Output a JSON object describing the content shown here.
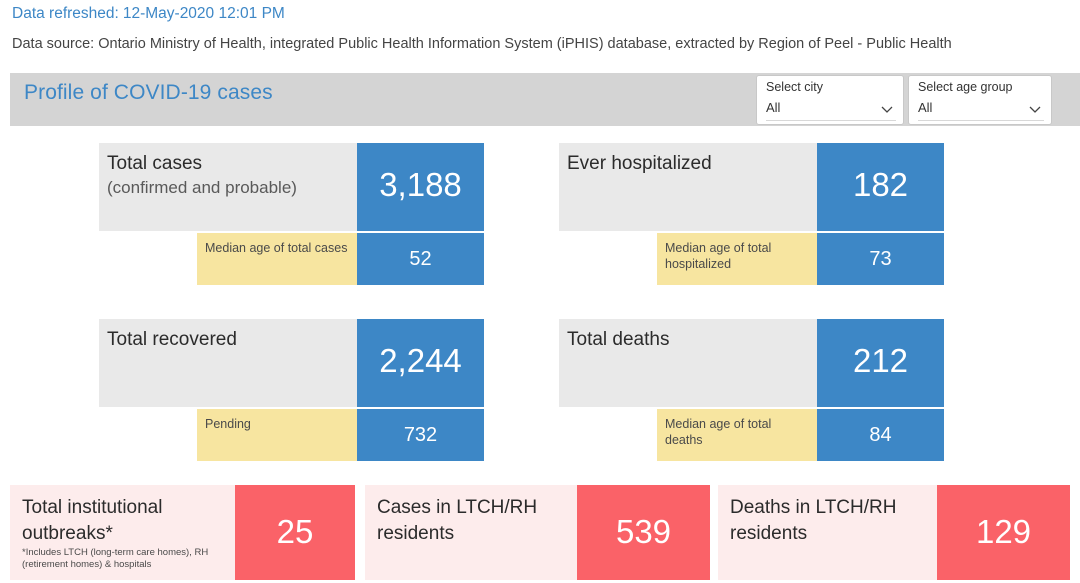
{
  "meta": {
    "refreshed_label": "Data refreshed:",
    "refreshed_value": "12-May-2020 12:01 PM",
    "source": "Data source: Ontario Ministry of Health, integrated Public Health Information System (iPHIS) database, extracted by Region of Peel - Public Health"
  },
  "header": {
    "title": "Profile of COVID-19 cases",
    "band_color": "#d4d4d4",
    "title_color": "#3d87c6"
  },
  "slicers": [
    {
      "label": "Select city",
      "value": "All",
      "icon": "chevron-down-icon"
    },
    {
      "label": "Select age group",
      "value": "All",
      "icon": "chevron-down-icon"
    }
  ],
  "kpi_cards": [
    {
      "title": "Total cases",
      "subtitle": "(confirmed and probable)",
      "value": "3,188",
      "sub_label": "Median age of total cases",
      "sub_value": "52"
    },
    {
      "title": "Ever hospitalized",
      "subtitle": "",
      "value": "182",
      "sub_label": "Median age of total hospitalized",
      "sub_value": "73"
    },
    {
      "title": "Total recovered",
      "subtitle": "",
      "value": "2,244",
      "sub_label": "Pending",
      "sub_value": "732"
    },
    {
      "title": "Total deaths",
      "subtitle": "",
      "value": "212",
      "sub_label": "Median age of total deaths",
      "sub_value": "84"
    }
  ],
  "outbreak_cards": [
    {
      "title": "Total institutional outbreaks*",
      "note": "*Includes LTCH (long-term care homes), RH (retirement homes) & hospitals",
      "value": "25"
    },
    {
      "title": "Cases in LTCH/RH residents",
      "note": "",
      "value": "539"
    },
    {
      "title": "Deaths in LTCH/RH residents",
      "note": "",
      "value": "129"
    }
  ],
  "colors": {
    "accent_blue": "#3d87c6",
    "gray_block": "#e9e9e9",
    "yellow_block": "#f7e5a0",
    "red_block": "#fa6268",
    "pale_pink": "#fdecec"
  }
}
